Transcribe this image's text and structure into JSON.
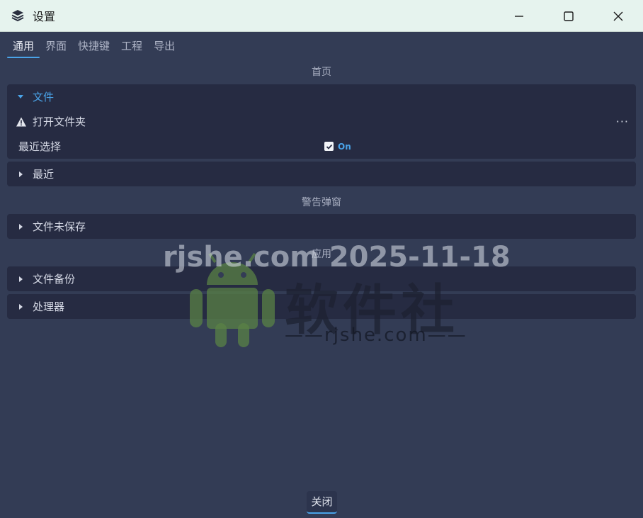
{
  "window": {
    "title": "设置",
    "controls": [
      "minimize",
      "maximize",
      "close"
    ]
  },
  "tabs": [
    {
      "label": "通用",
      "active": true
    },
    {
      "label": "界面",
      "active": false
    },
    {
      "label": "快捷键",
      "active": false
    },
    {
      "label": "工程",
      "active": false
    },
    {
      "label": "导出",
      "active": false
    }
  ],
  "sections": {
    "home": {
      "header": "首页",
      "groups": {
        "files": {
          "title": "文件",
          "expanded": true,
          "rows": {
            "open_folder": {
              "label": "打开文件夹",
              "icon": "warning-icon",
              "menu": "···"
            },
            "recent_select": {
              "label": "最近选择",
              "checked": true,
              "state_label": "On"
            }
          }
        },
        "recent": {
          "title": "最近",
          "expanded": false
        }
      }
    },
    "alerts": {
      "header": "警告弹窗",
      "groups": {
        "unsaved": {
          "title": "文件未保存",
          "expanded": false
        }
      }
    },
    "app": {
      "header": "应用",
      "groups": {
        "backup": {
          "title": "文件备份",
          "expanded": false
        },
        "processor": {
          "title": "处理器",
          "expanded": false
        }
      }
    }
  },
  "footer": {
    "close_label": "关闭"
  },
  "watermark": {
    "line1": "rjshe.com 2025-11-18",
    "brand": "软件社",
    "sub": "——rjshe.com——"
  },
  "colors": {
    "background": "#333c55",
    "panel": "#262b42",
    "accent": "#4aa3e8",
    "titlebar": "#e6f3ee"
  }
}
